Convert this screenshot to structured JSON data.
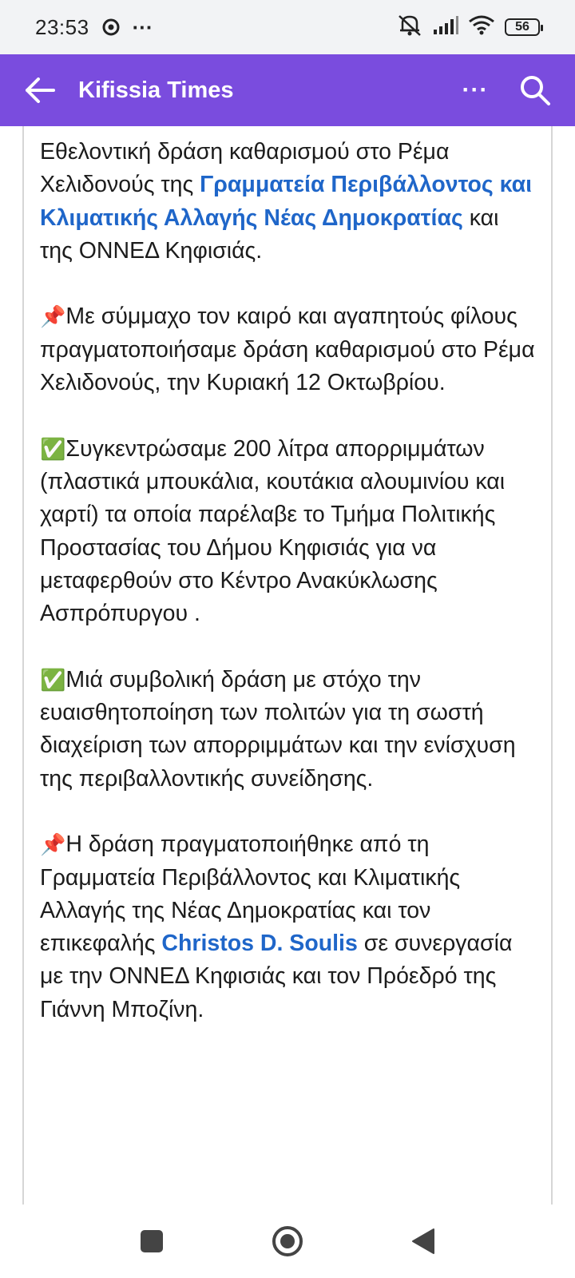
{
  "status_bar": {
    "time": "23:53",
    "more": "···",
    "battery": "56",
    "icons": [
      "chrome-icon",
      "mute-icon",
      "signal-icon",
      "wifi-icon",
      "battery-icon"
    ]
  },
  "app_bar": {
    "title": "Kifissia Times",
    "more_label": "···",
    "accent": "#7a4cde"
  },
  "post": {
    "p1": {
      "t1": "Εθελοντική δράση καθαρισμού στο Ρέμα Χελιδονούς της ",
      "link": "Γραμματεία Περιβάλλοντος και Κλιματικής Αλλαγής Νέας Δημοκρατίας",
      "t2": " και της ΟΝΝΕΔ Κηφισιάς."
    },
    "p2": {
      "emoji": "📌",
      "text": "Με σύμμαχο τον καιρό και αγαπητούς φίλους πραγματοποιήσαμε δράση καθαρισμού στο Ρέμα Χελιδονούς, την Κυριακή 12 Οκτωβρίου."
    },
    "p3": {
      "emoji": "✅",
      "text": "Συγκεντρώσαμε 200 λίτρα απορριμμάτων (πλαστικά μπουκάλια, κουτάκια αλουμινίου και χαρτί) τα οποία παρέλαβε το Τμήμα Πολιτικής Προστασίας του Δήμου Κηφισιάς για να μεταφερθούν στο Κέντρο Ανακύκλωσης Ασπρόπυργου ."
    },
    "p4": {
      "emoji": "✅",
      "text": "Μιά συμβολική δράση με στόχο την ευαισθητοποίηση των πολιτών για τη σωστή διαχείριση των απορριμμάτων και την ενίσχυση της περιβαλλοντικής συνείδησης."
    },
    "p5": {
      "emoji": "📌",
      "t1": "Η δράση πραγματοποιήθηκε από τη Γραμματεία  Περιβάλλοντος και Κλιματικής Αλλαγής της Νέας Δημοκρατίας και τον επικεφαλής ",
      "link": "Christos D. Soulis",
      "t2": "  σε συνεργασία με την ΟΝΝΕΔ Κηφισιάς και τον Πρόεδρό της Γιάννη Μποζίνη."
    },
    "link_color": "#1f66c9"
  },
  "nav_bar": {
    "buttons": [
      "recents-button",
      "home-button",
      "back-button"
    ]
  }
}
